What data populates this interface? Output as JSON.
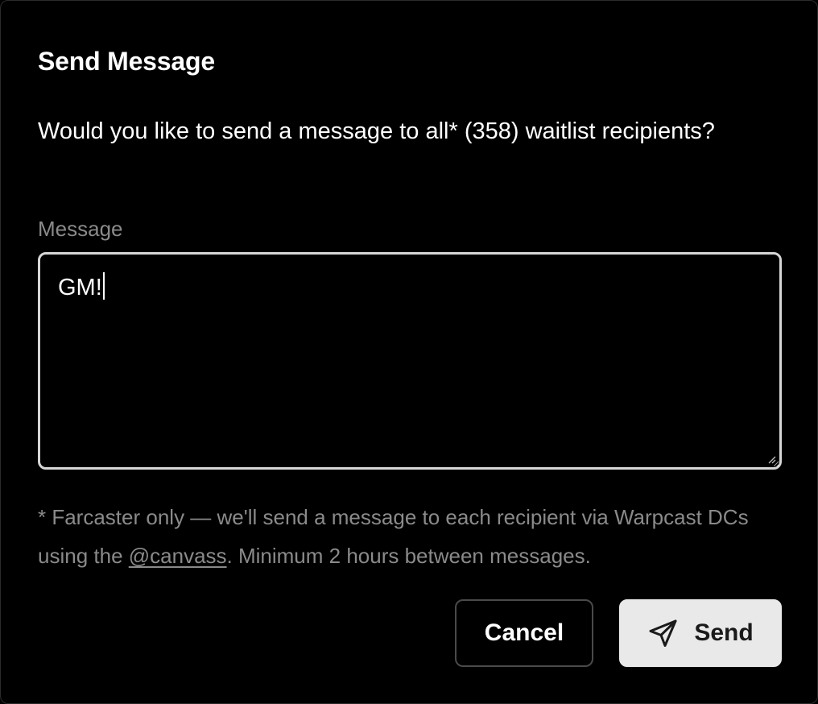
{
  "dialog": {
    "title": "Send Message",
    "description": "Would you like to send a message to all* (358) waitlist recipients?",
    "message_label": "Message",
    "message_value": "GM!",
    "footnote": {
      "prefix": "* Farcaster only — we'll send a message to each recipient via Warpcast DCs using the ",
      "link_text": "@canvass",
      "suffix": ". Minimum 2 hours between messages."
    },
    "buttons": {
      "cancel_label": "Cancel",
      "send_label": "Send",
      "send_icon": "paper-plane-icon"
    }
  },
  "colors": {
    "background": "#000000",
    "text_primary": "#ffffff",
    "text_muted": "#8a8a8a",
    "input_border": "#d6d6d6",
    "cancel_border": "#4a4a4a",
    "send_background": "#e9e9e9"
  }
}
